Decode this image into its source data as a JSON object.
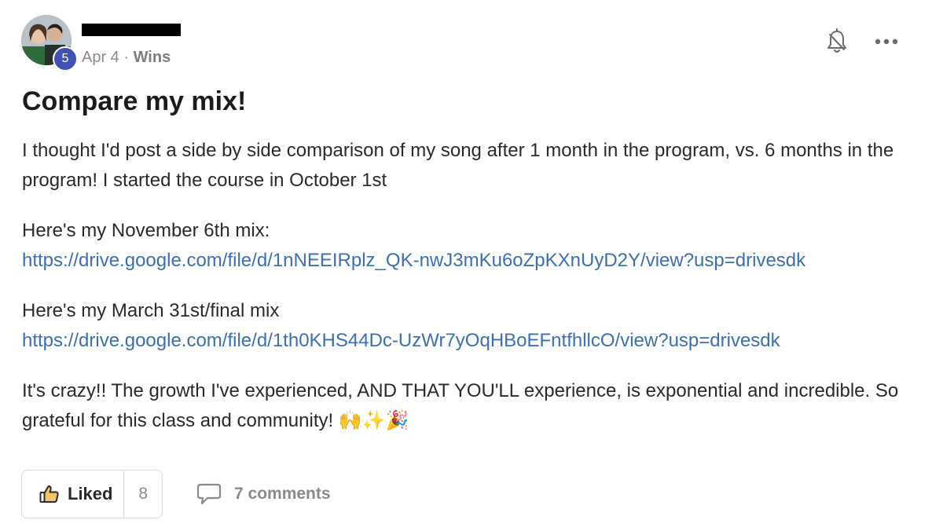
{
  "post": {
    "author": {
      "name": "",
      "level": "5"
    },
    "date": "Apr 4",
    "separator": "·",
    "category": "Wins",
    "title": "Compare my mix!",
    "paragraphs": {
      "intro": "I thought I'd post a side by side comparison of my song after 1 month in the program, vs. 6 months in the program! I started the course in October 1st",
      "nov_label": "Here's my November 6th mix:",
      "nov_link": "https://drive.google.com/file/d/1nNEEIRplz_QK-nwJ3mKu6oZpKXnUyD2Y/view?usp=drivesdk",
      "mar_label": "Here's my March 31st/final mix",
      "mar_link": "https://drive.google.com/file/d/1th0KHS44Dc-UzWr7yOqHBoEFntfhllcO/view?usp=drivesdk",
      "closing": "It's crazy!! The growth I've experienced, AND THAT YOU'LL experience, is exponential and incredible. So grateful for this class and community! 🙌✨🎉"
    },
    "actions": {
      "like_label": "Liked",
      "like_count": "8",
      "comments_label": "7 comments"
    },
    "icons": {
      "notification": "bell-off-icon",
      "more": "more-horizontal-icon",
      "like": "thumbs-up-icon",
      "comment": "comment-bubble-icon"
    },
    "colors": {
      "link": "#3b6fb6",
      "badge": "#3f51b5",
      "muted": "#8a8a8a"
    }
  }
}
